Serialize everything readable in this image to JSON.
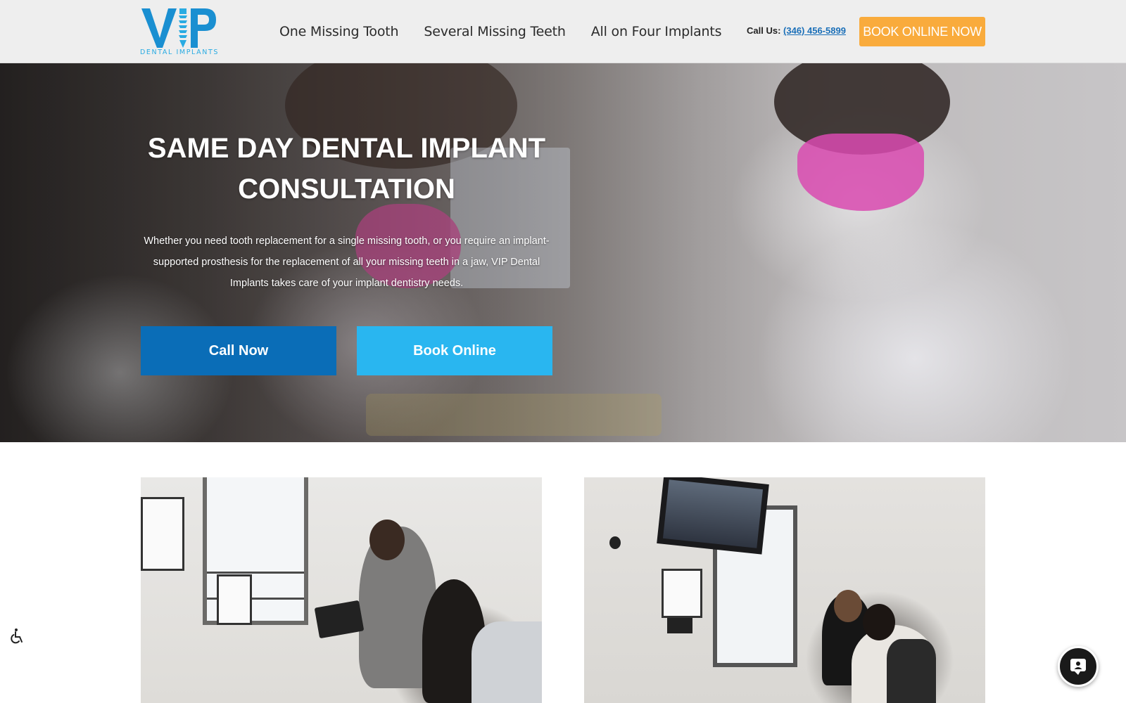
{
  "header": {
    "logo": {
      "wordmark": "VIP",
      "subtitle": "DENTAL IMPLANTS"
    },
    "nav": [
      {
        "label": "One Missing Tooth"
      },
      {
        "label": "Several Missing Teeth"
      },
      {
        "label": "All on Four Implants"
      }
    ],
    "call_us": {
      "label": "Call Us:",
      "phone": "(346) 456-5899"
    },
    "book_button": "BOOK ONLINE NOW"
  },
  "hero": {
    "title_line1": "SAME DAY DENTAL IMPLANT",
    "title_line2": "CONSULTATION",
    "text": "Whether you need tooth replacement for a single missing tooth, or you require an implant-supported prosthesis for the replacement of all your missing teeth in a jaw, VIP Dental Implants takes care of your implant dentistry needs.",
    "call_button": "Call Now",
    "book_button": "Book Online"
  },
  "widgets": {
    "accessibility_icon": "wheelchair-icon",
    "chat_icon": "chat-icon"
  },
  "colors": {
    "brand_blue": "#1a8fd1",
    "logo_light_blue": "#29abe2",
    "cta_orange": "#f9ab3c",
    "call_button": "#0a6db7",
    "book_button": "#29b6f0",
    "header_bg": "#eeeeee"
  }
}
